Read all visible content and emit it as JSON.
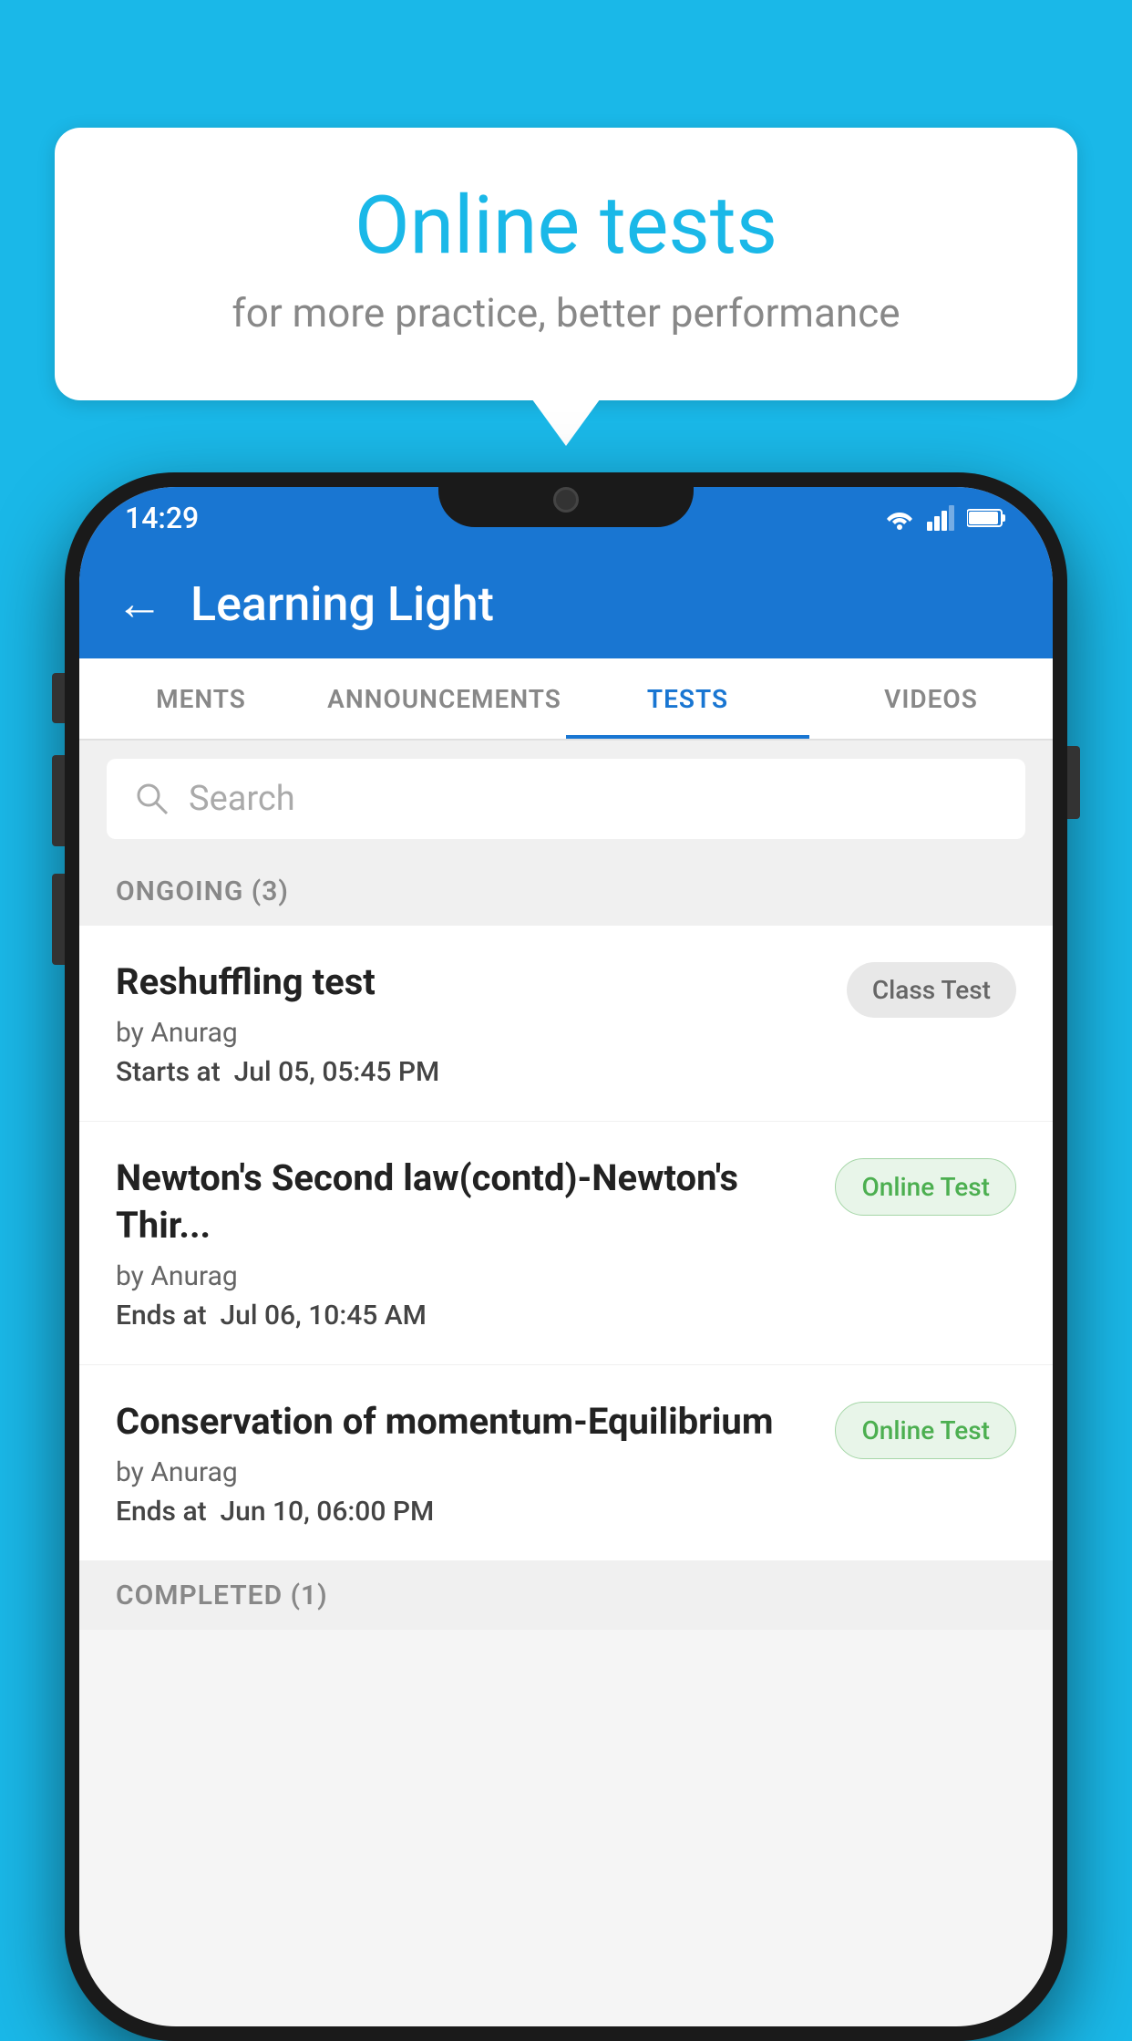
{
  "background_color": "#1ab8e8",
  "speech_bubble": {
    "title": "Online tests",
    "subtitle": "for more practice, better performance"
  },
  "phone": {
    "status_bar": {
      "time": "14:29"
    },
    "app_bar": {
      "title": "Learning Light",
      "back_label": "←"
    },
    "tabs": [
      {
        "label": "MENTS",
        "active": false
      },
      {
        "label": "ANNOUNCEMENTS",
        "active": false
      },
      {
        "label": "TESTS",
        "active": true
      },
      {
        "label": "VIDEOS",
        "active": false
      }
    ],
    "search": {
      "placeholder": "Search"
    },
    "sections": {
      "ongoing": {
        "label": "ONGOING (3)",
        "tests": [
          {
            "title": "Reshuffling test",
            "author": "by Anurag",
            "time_label": "Starts at",
            "time_value": "Jul 05, 05:45 PM",
            "badge_text": "Class Test",
            "badge_type": "class"
          },
          {
            "title": "Newton's Second law(contd)-Newton's Thir...",
            "author": "by Anurag",
            "time_label": "Ends at",
            "time_value": "Jul 06, 10:45 AM",
            "badge_text": "Online Test",
            "badge_type": "online"
          },
          {
            "title": "Conservation of momentum-Equilibrium",
            "author": "by Anurag",
            "time_label": "Ends at",
            "time_value": "Jun 10, 06:00 PM",
            "badge_text": "Online Test",
            "badge_type": "online"
          }
        ]
      },
      "completed": {
        "label": "COMPLETED (1)"
      }
    }
  }
}
